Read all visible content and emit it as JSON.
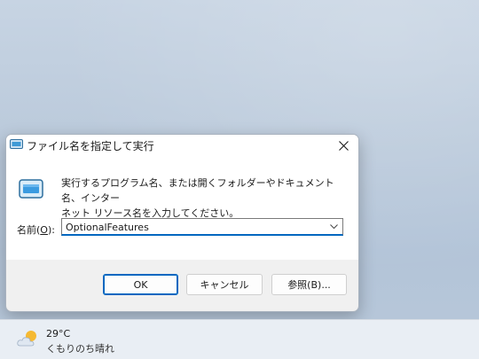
{
  "dialog": {
    "title": "ファイル名を指定して実行",
    "description_line1": "実行するプログラム名、または開くフォルダーやドキュメント名、インター",
    "description_line2": "ネット リソース名を入力してください。",
    "name_label_prefix": "名前(",
    "name_label_key": "O",
    "name_label_suffix": "):",
    "input_value": "OptionalFeatures",
    "ok_label": "OK",
    "cancel_label": "キャンセル",
    "browse_label": "参照(B)..."
  },
  "taskbar": {
    "weather_temp": "29°C",
    "weather_condition": "くもりのち晴れ"
  },
  "colors": {
    "accent": "#0067c0",
    "dialog_bg": "#f0f0f0",
    "wallpaper": "#bccbdc"
  },
  "icons": {
    "title": "run-icon",
    "close": "close-icon",
    "program": "run-program-icon",
    "dropdown": "chevron-down-icon",
    "weather": "partly-cloudy-icon"
  }
}
